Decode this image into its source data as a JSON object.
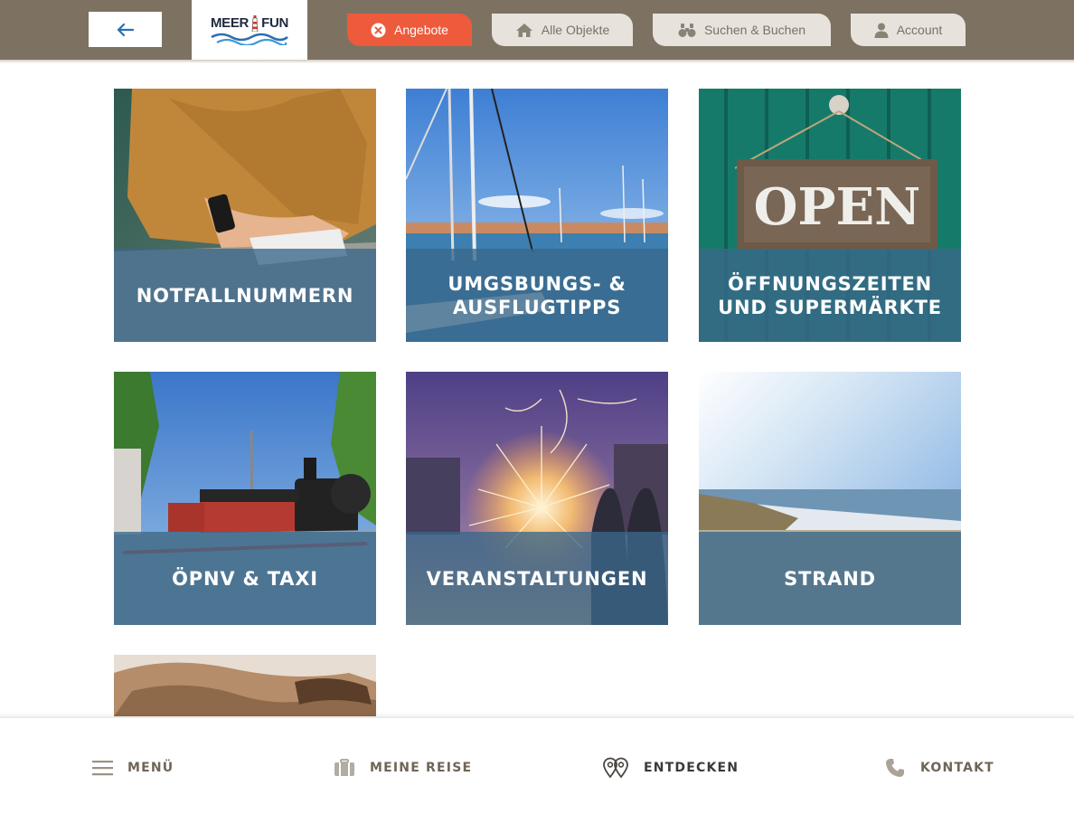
{
  "header": {
    "back_label": "←",
    "logo": {
      "text_left": "MEER",
      "text_right": "FUN"
    },
    "nav": [
      {
        "label": "Angebote",
        "icon": "close-circle-icon",
        "active": true
      },
      {
        "label": "Alle Objekte",
        "icon": "home-icon",
        "active": false
      },
      {
        "label": "Suchen & Buchen",
        "icon": "binoculars-icon",
        "active": false
      },
      {
        "label": "Account",
        "icon": "user-icon",
        "active": false
      }
    ]
  },
  "tiles": [
    {
      "label": "NOTFALLNUMMERN",
      "scene": "person-with-phone"
    },
    {
      "label": "UMGSBUNGS- &\nAUSFLUGTIPPS",
      "scene": "harbor-sailboats"
    },
    {
      "label": "ÖFFNUNGSZEITEN\nUND SUPERMÄRKTE",
      "scene": "open-sign"
    },
    {
      "label": "ÖPNV & TAXI",
      "scene": "steam-train"
    },
    {
      "label": "VERANSTALTUNGEN",
      "scene": "fireworks"
    },
    {
      "label": "STRAND",
      "scene": "beach"
    },
    {
      "label": "",
      "scene": "sleeping-cat-partial"
    }
  ],
  "bottom_nav": [
    {
      "label": "MENÜ",
      "icon": "hamburger-icon"
    },
    {
      "label": "MEINE REISE",
      "icon": "luggage-icon"
    },
    {
      "label": "ENTDECKEN",
      "icon": "map-pins-icon",
      "current": true
    },
    {
      "label": "KONTAKT",
      "icon": "phone-icon"
    }
  ],
  "colors": {
    "header_bg": "#7d7262",
    "accent": "#ee5a3c",
    "nav_button_bg": "#e7e3dc",
    "tile_overlay": "#3a688a"
  }
}
